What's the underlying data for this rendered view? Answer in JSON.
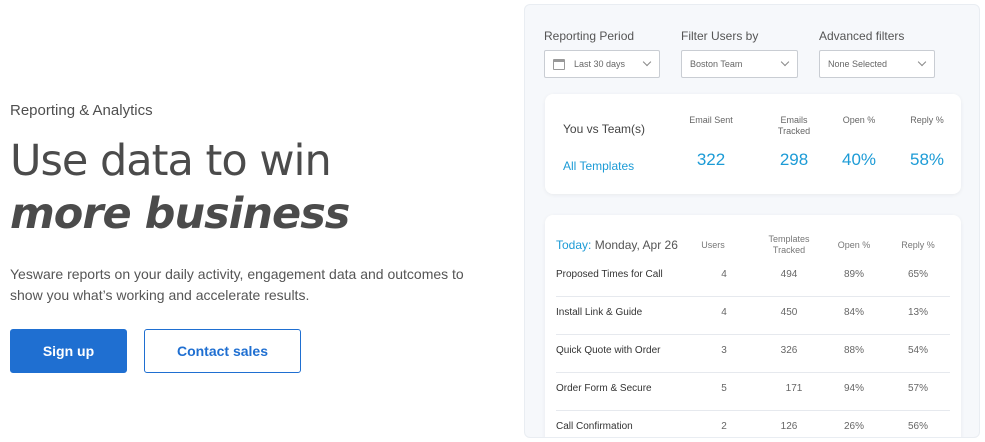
{
  "hero": {
    "eyebrow": "Reporting & Analytics",
    "headline_line1": "Use data to win",
    "headline_line2": "more business",
    "description": "Yesware reports on your daily activity, engagement data and outcomes to show you what’s working and accelerate results.",
    "signup_label": "Sign up",
    "contact_label": "Contact sales"
  },
  "colors": {
    "brand_blue": "#1f6fd1",
    "accent_cyan": "#1c9bd6"
  },
  "filters": [
    {
      "label": "Reporting Period",
      "value": "Last 30 days",
      "icon": "calendar-icon"
    },
    {
      "label": "Filter Users by",
      "value": "Boston Team"
    },
    {
      "label": "Advanced filters",
      "value": "None Selected"
    }
  ],
  "comparison": {
    "title": "You vs Team(s)",
    "link": "All Templates",
    "stats": [
      {
        "label": "Email Sent",
        "value": "322"
      },
      {
        "label": "Emails Tracked",
        "value": "298"
      },
      {
        "label": "Open %",
        "value": "40%"
      },
      {
        "label": "Reply %",
        "value": "58%"
      }
    ]
  },
  "today_table": {
    "today_label": "Today:",
    "date": "Monday, Apr 26",
    "headers": [
      "Users",
      "Templates Tracked",
      "Open %",
      "Reply %"
    ],
    "rows": [
      {
        "name": "Proposed Times for Call",
        "users": "4",
        "templates": "494",
        "open": "89%",
        "reply": "65%"
      },
      {
        "name": "Install Link  & Guide",
        "users": "4",
        "templates": "450",
        "open": "84%",
        "reply": "13%"
      },
      {
        "name": "Quick Quote with Order",
        "users": "3",
        "templates": "326",
        "open": "88%",
        "reply": "54%"
      },
      {
        "name": "Order Form & Secure",
        "users": "5",
        "templates": "171",
        "open": "94%",
        "reply": "57%"
      },
      {
        "name": "Call Confirmation",
        "users": "2",
        "templates": "126",
        "open": "26%",
        "reply": "56%"
      }
    ]
  }
}
